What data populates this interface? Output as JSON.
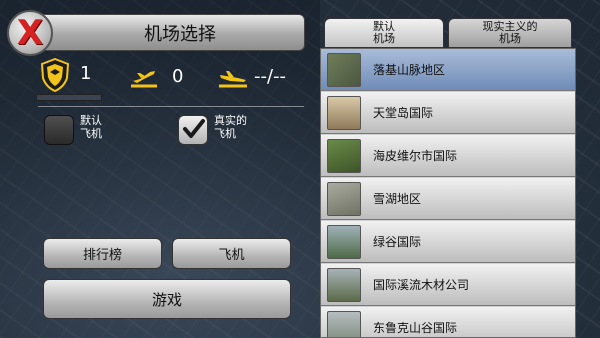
{
  "screen": {
    "title": "机场选择"
  },
  "close": {
    "label": "X"
  },
  "stats": {
    "level": "1",
    "takeoffs": "0",
    "landings": "--/--"
  },
  "options": {
    "default_planes_label": "默认\n飞机",
    "default_planes_checked": false,
    "realistic_planes_label": "真实的\n飞机",
    "realistic_planes_checked": true
  },
  "buttons": {
    "leaderboard": "排行榜",
    "aircraft": "飞机",
    "play": "游戏"
  },
  "tabs": [
    {
      "label": "默认\n机场",
      "active": true
    },
    {
      "label": "现实主义的\n机场",
      "active": false
    }
  ],
  "airports": [
    {
      "name": "落基山脉地区",
      "selected": true,
      "thumb_color": "#5e6a4b"
    },
    {
      "name": "天堂岛国际",
      "selected": false,
      "thumb_color": "#b9a27d"
    },
    {
      "name": "海皮维尔市国际",
      "selected": false,
      "thumb_color": "#4f6a38"
    },
    {
      "name": "雪湖地区",
      "selected": false,
      "thumb_color": "#8a8e86"
    },
    {
      "name": "绿谷国际",
      "selected": false,
      "thumb_color": "#5e7a57"
    },
    {
      "name": "国际溪流木材公司",
      "selected": false,
      "thumb_color": "#6d7a5a"
    },
    {
      "name": "东鲁克山谷国际",
      "selected": false,
      "thumb_color": "#7c8a7a"
    }
  ],
  "colors": {
    "accent_yellow": "#f2c318",
    "close_red": "#d62222",
    "selected_row": "#8aa2c8"
  }
}
